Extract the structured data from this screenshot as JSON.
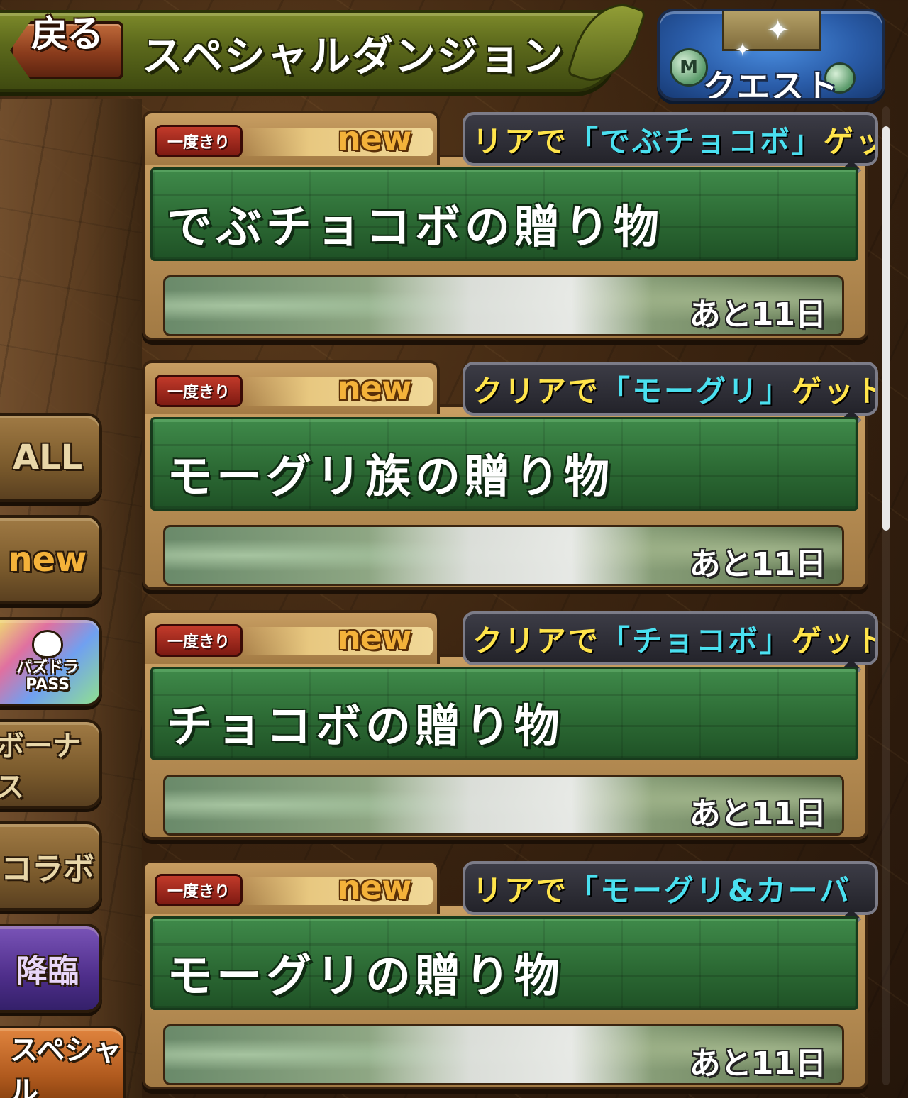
{
  "header": {
    "back_label": "戻る",
    "title": "スペシャルダンジョン",
    "quest_label": "クエスト",
    "quest_coin_letter": "M"
  },
  "tabs": [
    {
      "label": "ALL",
      "style": "brown"
    },
    {
      "label": "new",
      "style": "brown"
    },
    {
      "label": "パズドラ PASS",
      "style": "pass"
    },
    {
      "label": "ボーナス",
      "style": "brown"
    },
    {
      "label": "コラボ",
      "style": "brown"
    },
    {
      "label": "降臨",
      "style": "purple"
    },
    {
      "label": "スペシャル",
      "style": "special",
      "selected": true
    }
  ],
  "dungeons": [
    {
      "once_label": "一度きり",
      "new_label": "new",
      "reward_text": "リアで「でぶチョコボ」ゲッ",
      "name": "でぶチョコボの贈り物",
      "remaining": "あと11日"
    },
    {
      "once_label": "一度きり",
      "new_label": "new",
      "reward_text": "クリアで「モーグリ」ゲット！",
      "name": "モーグリ族の贈り物",
      "remaining": "あと11日"
    },
    {
      "once_label": "一度きり",
      "new_label": "new",
      "reward_text": "クリアで「チョコボ」ゲット！",
      "name": "チョコボの贈り物",
      "remaining": "あと11日"
    },
    {
      "once_label": "一度きり",
      "new_label": "new",
      "reward_text": "リアで「モーグリ&カーバ",
      "name": "モーグリの贈り物",
      "remaining": "あと11日"
    }
  ],
  "colors": {
    "header_green": "#5d6a1c",
    "card_green": "#2c6a34",
    "reward_text": "#ffe44a",
    "reward_quote": "#4ae0f0",
    "new_orange": "#f4b23a"
  }
}
